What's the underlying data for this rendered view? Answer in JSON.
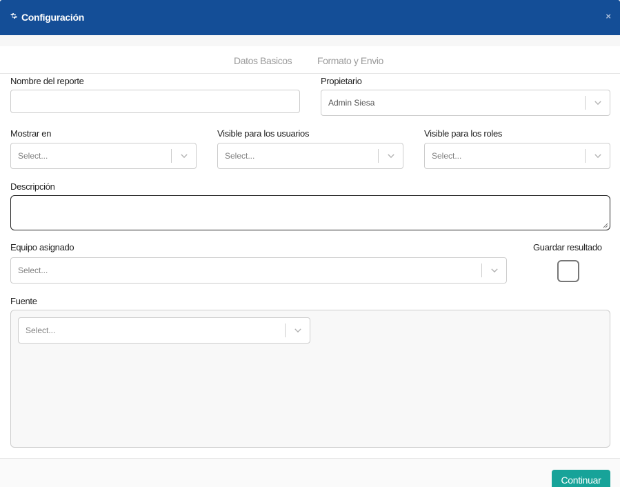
{
  "header": {
    "title": "Configuración",
    "close_glyph": "×",
    "icon": "gear-icon"
  },
  "tabs": [
    {
      "label": "Datos Basicos"
    },
    {
      "label": "Formato y Envio"
    }
  ],
  "form": {
    "report_name": {
      "label": "Nombre del reporte",
      "value": ""
    },
    "owner": {
      "label": "Propietario",
      "value": "Admin Siesa"
    },
    "show_in": {
      "label": "Mostrar en",
      "placeholder": "Select..."
    },
    "visible_users": {
      "label": "Visible para los usuarios",
      "placeholder": "Select..."
    },
    "visible_roles": {
      "label": "Visible para los roles",
      "placeholder": "Select..."
    },
    "description": {
      "label": "Descripción",
      "value": ""
    },
    "team": {
      "label": "Equipo asignado",
      "placeholder": "Select..."
    },
    "save_result": {
      "label": "Guardar resultado",
      "checked": false
    },
    "source": {
      "label": "Fuente",
      "placeholder": "Select..."
    }
  },
  "footer": {
    "continue_label": "Continuar"
  },
  "colors": {
    "header_bg": "#144e97",
    "button_bg": "#17a399"
  }
}
